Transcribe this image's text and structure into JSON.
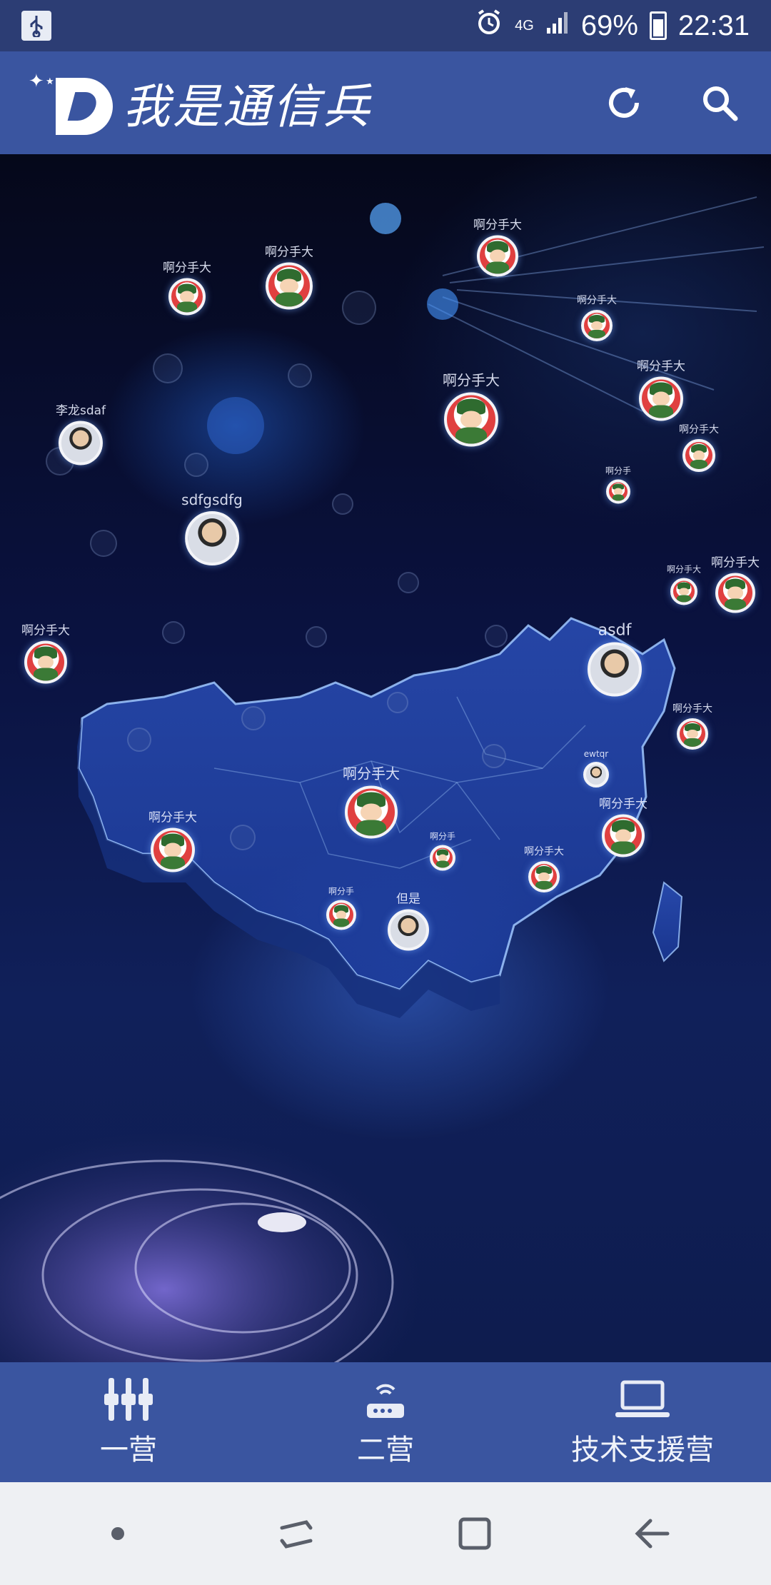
{
  "status_bar": {
    "network": "4G",
    "battery": "69%",
    "time": "22:31"
  },
  "header": {
    "title": "我是通信兵"
  },
  "markers": [
    {
      "label": "啊分手大"
    },
    {
      "label": "啊分手大"
    },
    {
      "label": "啊分手大"
    },
    {
      "label": "李龙sdaf"
    },
    {
      "label": "sdfgsdfg"
    },
    {
      "label": "啊分手大"
    },
    {
      "label": "asdf"
    },
    {
      "label": "啊分手大"
    },
    {
      "label": "啊分手大"
    },
    {
      "label": "啊分手大"
    },
    {
      "label": "但是"
    },
    {
      "label": "啊分手大"
    },
    {
      "label": "啊分手大"
    },
    {
      "label": "啊分手大"
    },
    {
      "label": "啊分手大"
    },
    {
      "label": "啊分手大"
    },
    {
      "label": "啊分手"
    },
    {
      "label": "啊分手大"
    },
    {
      "label": "啊分手大"
    },
    {
      "label": "啊分手大"
    },
    {
      "label": "ewtqr"
    },
    {
      "label": "啊分手"
    },
    {
      "label": "啊分手"
    }
  ],
  "tabs": [
    {
      "label": "一营",
      "icon": "sliders-icon"
    },
    {
      "label": "二营",
      "icon": "router-icon"
    },
    {
      "label": "技术支援营",
      "icon": "laptop-icon"
    }
  ],
  "colors": {
    "header_bg": "#3a55a0",
    "status_bg": "#2c3d74",
    "nav_bg": "#eef0f3"
  }
}
